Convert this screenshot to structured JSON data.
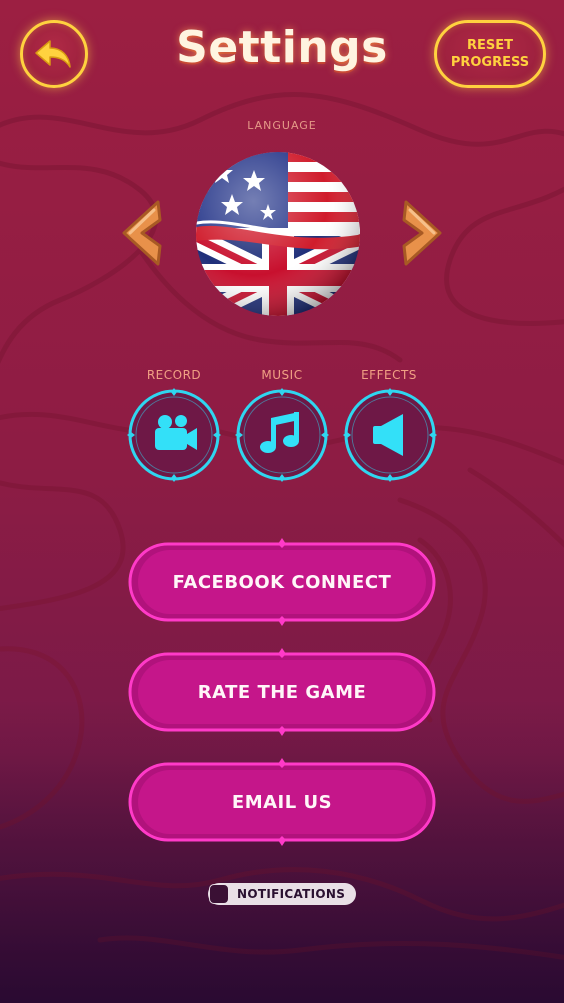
{
  "header": {
    "title": "Settings",
    "reset_label": "RESET PROGRESS"
  },
  "language": {
    "label": "LANGUAGE",
    "selected_flag": "us-uk-flag-icon"
  },
  "toggles": [
    {
      "label": "RECORD",
      "icon": "video-camera-icon"
    },
    {
      "label": "MUSIC",
      "icon": "music-note-icon"
    },
    {
      "label": "EFFECTS",
      "icon": "speaker-icon"
    }
  ],
  "buttons": {
    "facebook": "FACEBOOK CONNECT",
    "rate": "RATE THE GAME",
    "email": "EMAIL US"
  },
  "notifications": {
    "label": "NOTIFICATIONS",
    "checked": false
  },
  "colors": {
    "accent_yellow": "#ffd23f",
    "toggle_cyan": "#2fd6f0",
    "button_pink": "#ff3ac8",
    "background": "#9c1f42"
  }
}
